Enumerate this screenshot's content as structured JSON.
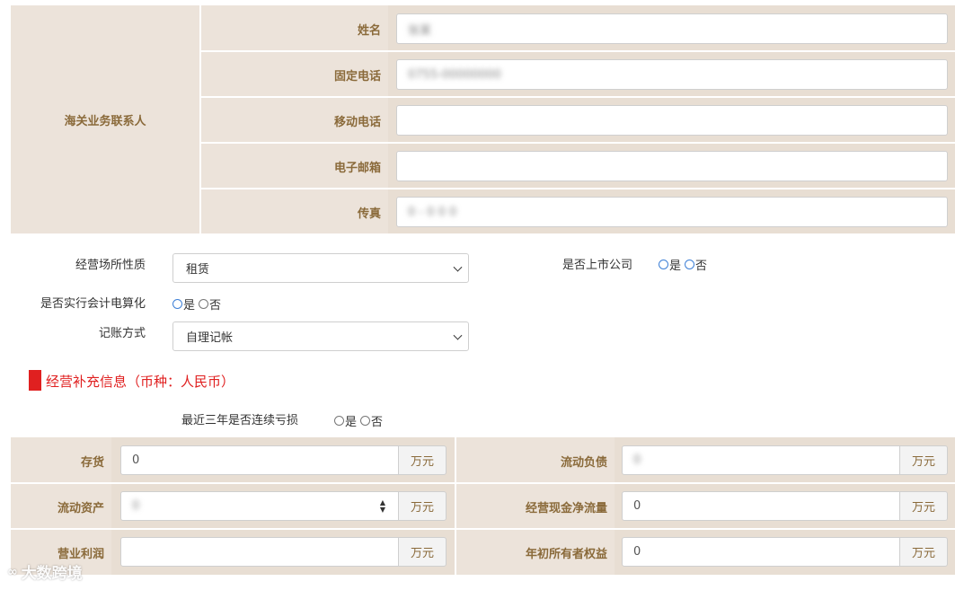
{
  "contact": {
    "group_label": "海关业务联系人",
    "rows": [
      {
        "label": "姓名",
        "value": "张某"
      },
      {
        "label": "固定电话",
        "value": "0755-00000000"
      },
      {
        "label": "移动电话",
        "value": ""
      },
      {
        "label": "电子邮箱",
        "value": ""
      },
      {
        "label": "传真",
        "value": "0 - 0 0 0"
      }
    ]
  },
  "business": {
    "premises_label": "经营场所性质",
    "premises_value": "租赁",
    "listed_label": "是否上市公司",
    "listed_yes": "是",
    "listed_no": "否",
    "computerized_label": "是否实行会计电算化",
    "computerized_yes": "是",
    "computerized_no": "否",
    "bookkeeping_label": "记账方式",
    "bookkeeping_value": "自理记帐"
  },
  "supplement": {
    "title": "经营补充信息（币种：人民币）",
    "accent_color": "#e02020",
    "loss_label": "最近三年是否连续亏损",
    "loss_yes": "是",
    "loss_no": "否"
  },
  "financials": {
    "unit": "万元",
    "left": [
      {
        "label": "存货",
        "value": "0"
      },
      {
        "label": "流动资产",
        "value": "0"
      },
      {
        "label": "营业利润",
        "value": ""
      }
    ],
    "right": [
      {
        "label": "流动负债",
        "value": "0"
      },
      {
        "label": "经营现金净流量",
        "value": "0"
      },
      {
        "label": "年初所有者权益",
        "value": "0"
      }
    ]
  },
  "watermark": {
    "text": "大数跨境"
  }
}
